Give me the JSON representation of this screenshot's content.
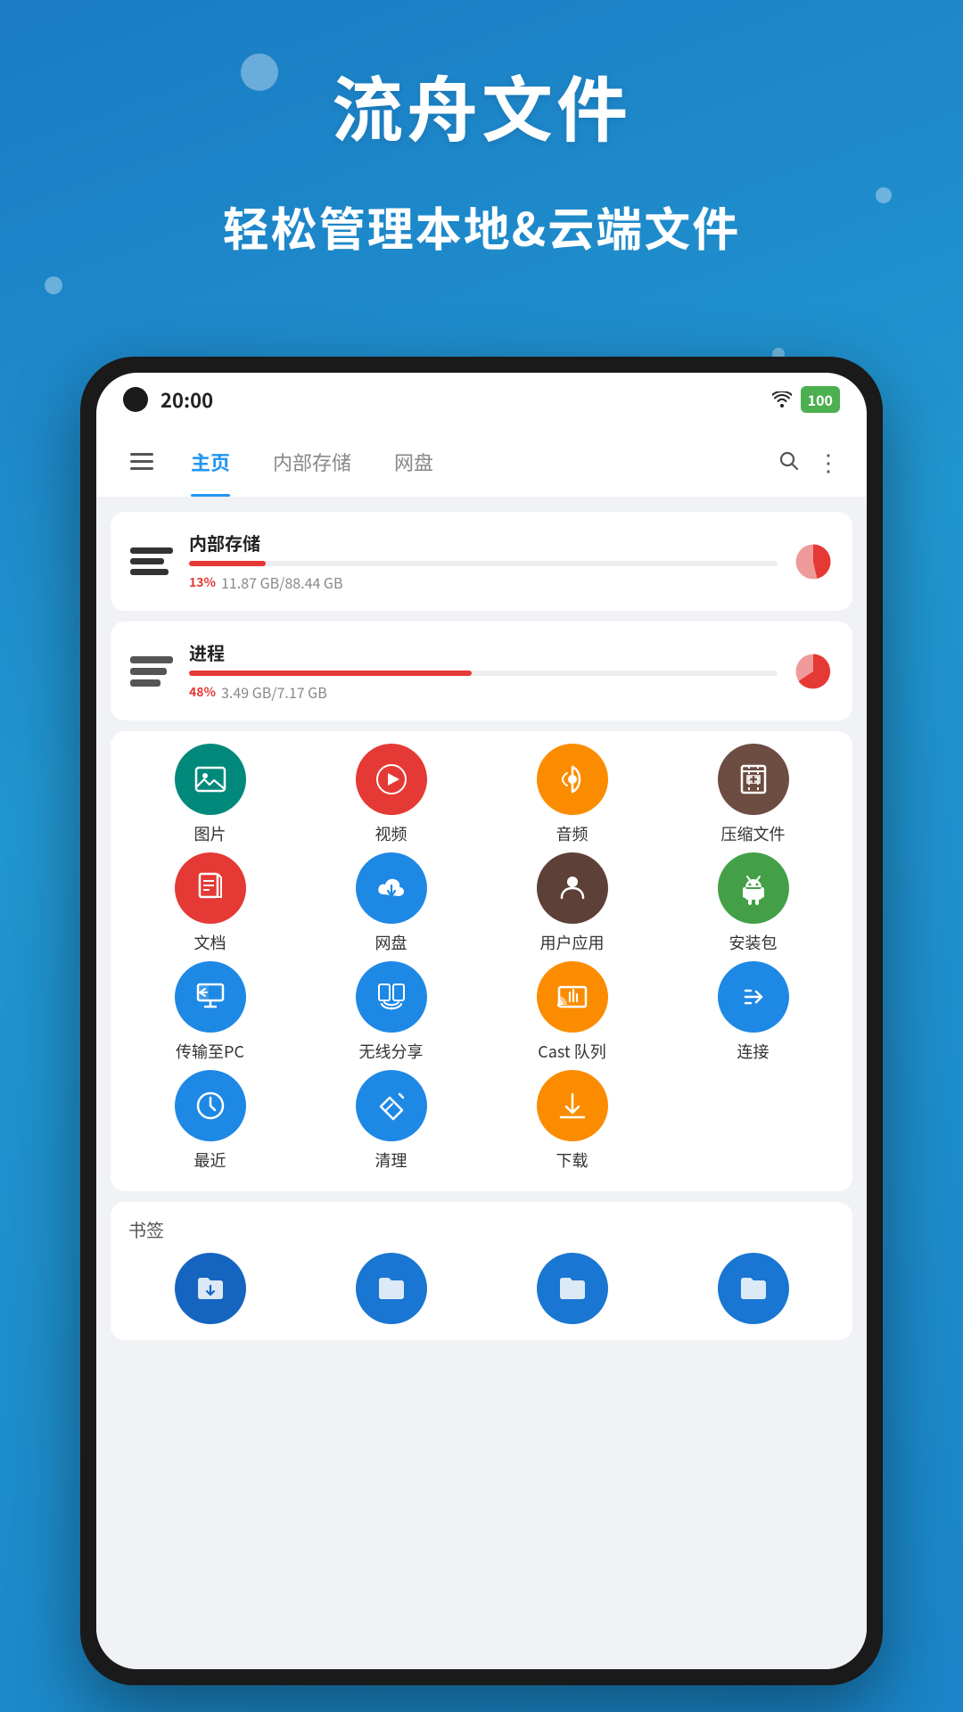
{
  "app": {
    "title": "流舟文件",
    "subtitle": "轻松管理本地&云端文件"
  },
  "status_bar": {
    "time": "20:00",
    "wifi": "📶",
    "battery": "100"
  },
  "nav": {
    "tabs": [
      {
        "label": "主页",
        "active": true
      },
      {
        "label": "内部存储",
        "active": false
      },
      {
        "label": "网盘",
        "active": false
      }
    ],
    "menu_icon": "☰",
    "search_icon": "🔍",
    "more_icon": "⋮"
  },
  "storage_cards": [
    {
      "name": "内部存储",
      "percent": 13,
      "percent_label": "13%",
      "used": "11.87 GB/88.44 GB",
      "pie_used_pct": 13
    },
    {
      "name": "进程",
      "percent": 48,
      "percent_label": "48%",
      "used": "3.49 GB/7.17 GB",
      "pie_used_pct": 48
    }
  ],
  "grid_items": [
    {
      "label": "图片",
      "color": "#00897B",
      "icon": "image"
    },
    {
      "label": "视频",
      "color": "#E53935",
      "icon": "video"
    },
    {
      "label": "音频",
      "color": "#FB8C00",
      "icon": "audio"
    },
    {
      "label": "压缩文件",
      "color": "#6D4C41",
      "icon": "archive"
    },
    {
      "label": "文档",
      "color": "#E53935",
      "icon": "doc"
    },
    {
      "label": "网盘",
      "color": "#1E88E5",
      "icon": "cloud"
    },
    {
      "label": "用户应用",
      "color": "#5D4037",
      "icon": "app"
    },
    {
      "label": "安装包",
      "color": "#43A047",
      "icon": "android"
    },
    {
      "label": "传输至PC",
      "color": "#1E88E5",
      "icon": "pc"
    },
    {
      "label": "无线分享",
      "color": "#1E88E5",
      "icon": "wireless"
    },
    {
      "label": "Cast 队列",
      "color": "#FB8C00",
      "icon": "cast"
    },
    {
      "label": "连接",
      "color": "#1E88E5",
      "icon": "connect"
    },
    {
      "label": "最近",
      "color": "#1E88E5",
      "icon": "recent"
    },
    {
      "label": "清理",
      "color": "#1E88E5",
      "icon": "clean"
    },
    {
      "label": "下载",
      "color": "#FB8C00",
      "icon": "download"
    }
  ],
  "bookmarks": {
    "title": "书签",
    "items": [
      {
        "label": "",
        "color": "#1976d2",
        "icon": "folder-down"
      },
      {
        "label": "",
        "color": "#1976d2",
        "icon": "folder"
      },
      {
        "label": "",
        "color": "#1976d2",
        "icon": "folder"
      },
      {
        "label": "",
        "color": "#1976d2",
        "icon": "folder"
      }
    ]
  }
}
